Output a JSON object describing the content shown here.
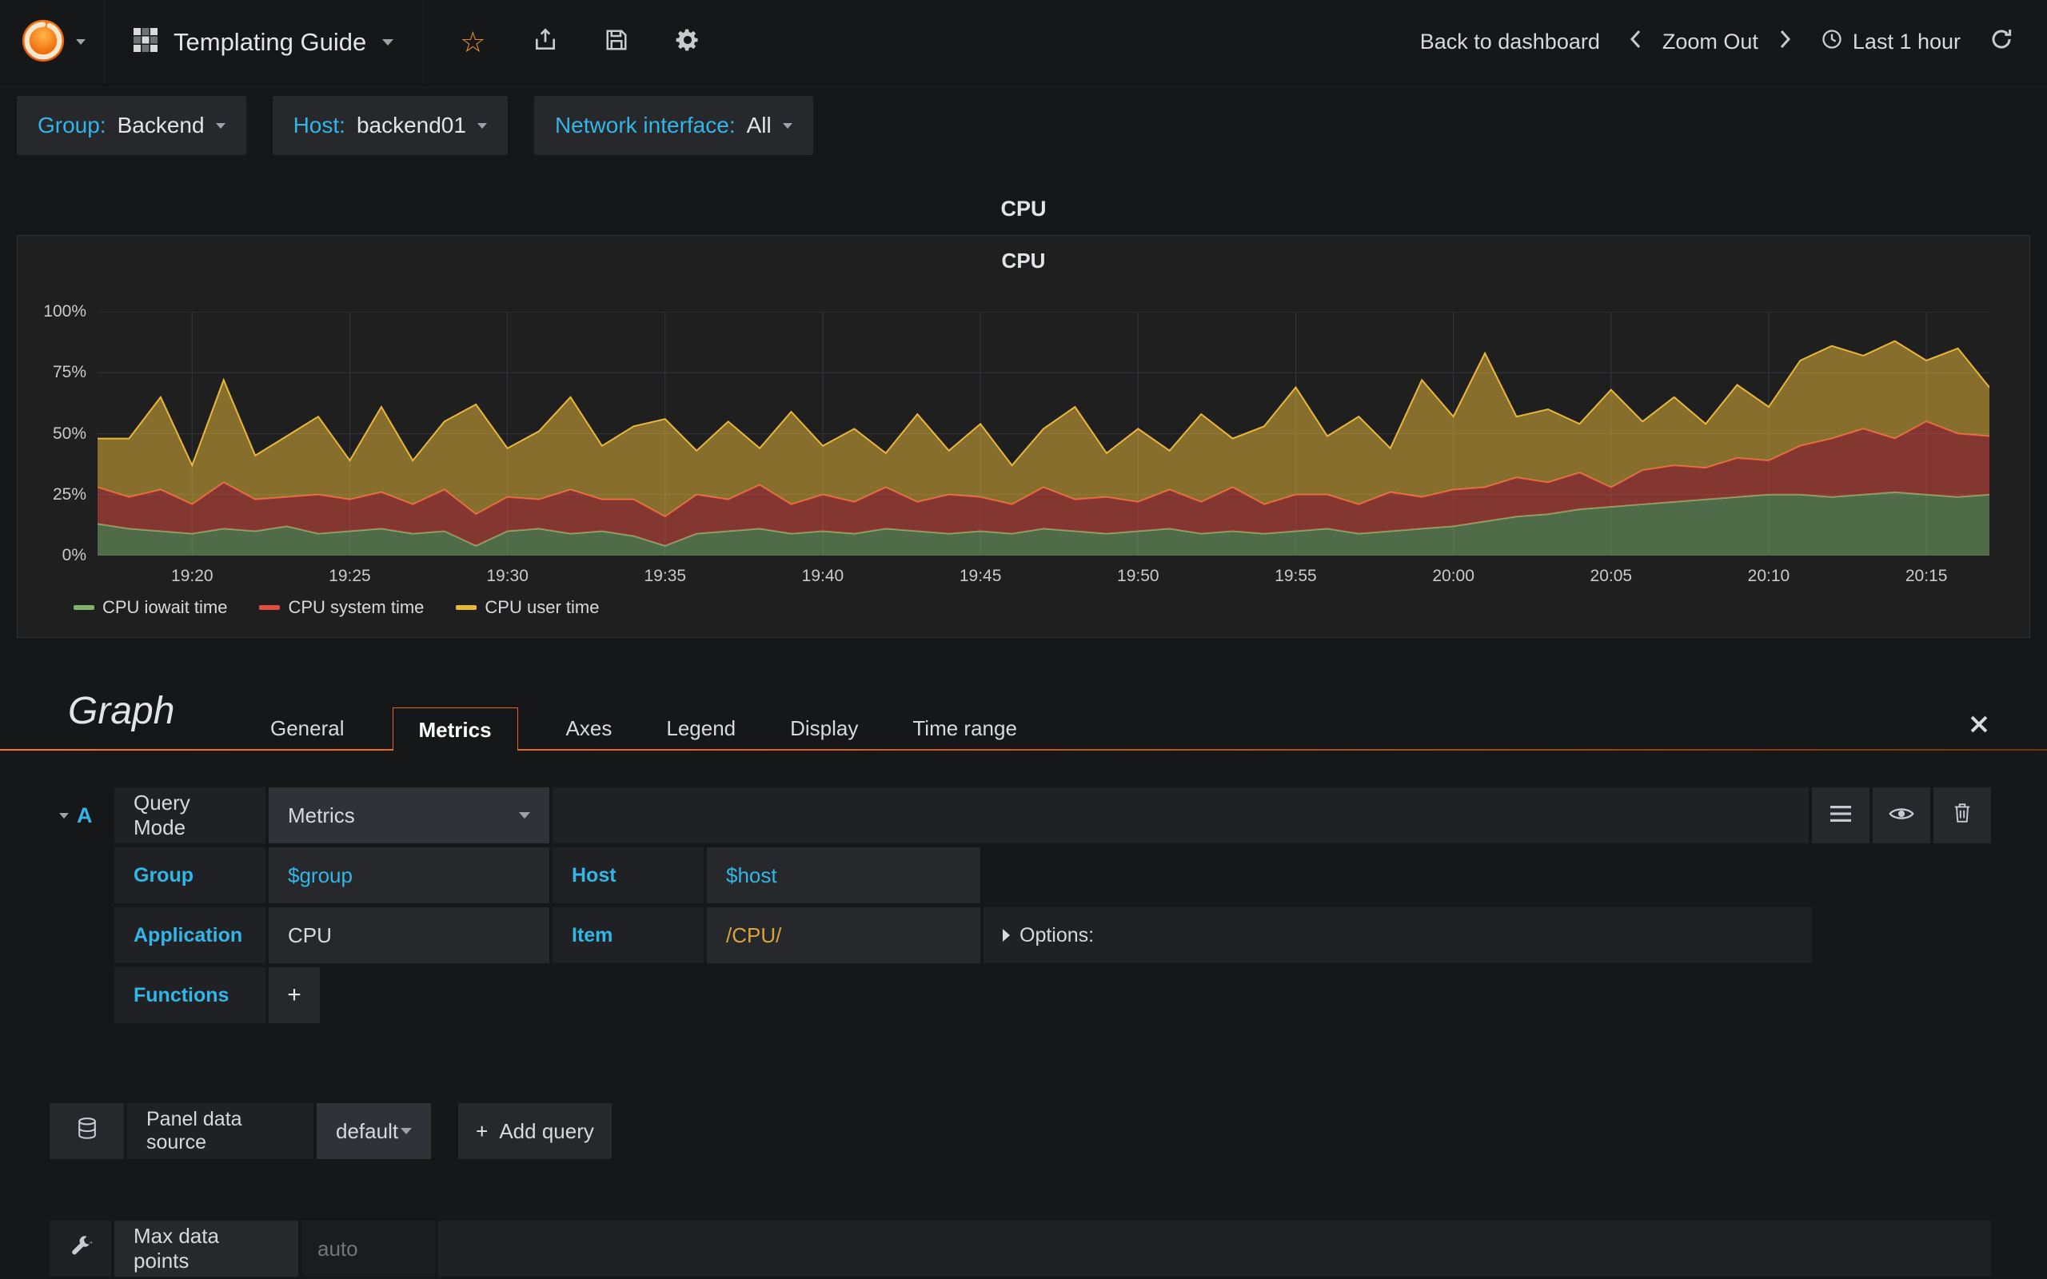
{
  "navbar": {
    "dashboard_title": "Templating Guide",
    "back_to_dashboard": "Back to dashboard",
    "zoom_out": "Zoom Out",
    "time_range": "Last 1 hour"
  },
  "icons": {
    "star": "☆",
    "plus": "+"
  },
  "colors": {
    "accent_orange": "#e3621d",
    "link_blue": "#33b5e5",
    "regex_gold": "#d8a539"
  },
  "variables": [
    {
      "label": "Group:",
      "value": "Backend"
    },
    {
      "label": "Host:",
      "value": "backend01"
    },
    {
      "label": "Network interface:",
      "value": "All"
    }
  ],
  "row_title": "CPU",
  "panel": {
    "title": "CPU"
  },
  "chart_data": {
    "type": "area",
    "stacked": true,
    "title": "CPU",
    "ylim": [
      0,
      100
    ],
    "y_ticks": [
      "0%",
      "25%",
      "50%",
      "75%",
      "100%"
    ],
    "x_ticks": [
      "19:20",
      "19:25",
      "19:30",
      "19:35",
      "19:40",
      "19:45",
      "19:50",
      "19:55",
      "20:00",
      "20:05",
      "20:10",
      "20:15"
    ],
    "x_tick_indices": [
      3,
      8,
      13,
      18,
      23,
      28,
      33,
      38,
      43,
      48,
      53,
      58
    ],
    "legend_position": "bottom",
    "series": [
      {
        "name": "CPU iowait time",
        "color": "#7EB26D",
        "values": [
          13,
          11,
          10,
          9,
          11,
          10,
          12,
          9,
          10,
          11,
          9,
          10,
          4,
          10,
          11,
          9,
          10,
          8,
          4,
          9,
          10,
          11,
          9,
          10,
          9,
          11,
          10,
          9,
          10,
          9,
          11,
          10,
          9,
          10,
          11,
          9,
          10,
          9,
          10,
          11,
          9,
          10,
          11,
          12,
          14,
          16,
          17,
          19,
          20,
          21,
          22,
          23,
          24,
          25,
          25,
          24,
          25,
          26,
          25,
          24,
          25
        ]
      },
      {
        "name": "CPU system time",
        "color": "#E24D42",
        "values": [
          15,
          13,
          17,
          12,
          19,
          13,
          12,
          16,
          13,
          15,
          12,
          17,
          13,
          14,
          12,
          18,
          13,
          15,
          12,
          16,
          13,
          18,
          12,
          15,
          13,
          17,
          12,
          16,
          14,
          12,
          17,
          13,
          15,
          12,
          16,
          13,
          18,
          12,
          15,
          14,
          12,
          16,
          13,
          15,
          14,
          16,
          13,
          15,
          8,
          14,
          15,
          13,
          16,
          14,
          20,
          24,
          27,
          22,
          30,
          26,
          24
        ]
      },
      {
        "name": "CPU user time",
        "color": "#EAB839",
        "values": [
          20,
          24,
          38,
          16,
          42,
          18,
          25,
          32,
          16,
          35,
          18,
          28,
          45,
          20,
          28,
          38,
          22,
          30,
          40,
          18,
          32,
          15,
          38,
          20,
          30,
          14,
          36,
          18,
          30,
          16,
          24,
          38,
          18,
          30,
          16,
          36,
          20,
          32,
          44,
          24,
          36,
          18,
          48,
          30,
          55,
          25,
          30,
          20,
          40,
          20,
          28,
          18,
          30,
          22,
          35,
          38,
          30,
          40,
          25,
          35,
          20
        ]
      }
    ]
  },
  "editor": {
    "panel_type": "Graph",
    "tabs": [
      "General",
      "Metrics",
      "Axes",
      "Legend",
      "Display",
      "Time range"
    ],
    "active_tab": "Metrics",
    "query": {
      "ref_id": "A",
      "query_mode_label": "Query Mode",
      "query_mode_value": "Metrics",
      "group_label": "Group",
      "group_value": "$group",
      "host_label": "Host",
      "host_value": "$host",
      "application_label": "Application",
      "application_value": "CPU",
      "item_label": "Item",
      "item_value": "/CPU/",
      "options_label": "Options:",
      "functions_label": "Functions"
    },
    "datasource": {
      "label": "Panel data source",
      "value": "default",
      "add_query_label": "Add query"
    },
    "max_data_points": {
      "label": "Max data points",
      "placeholder": "auto"
    }
  }
}
